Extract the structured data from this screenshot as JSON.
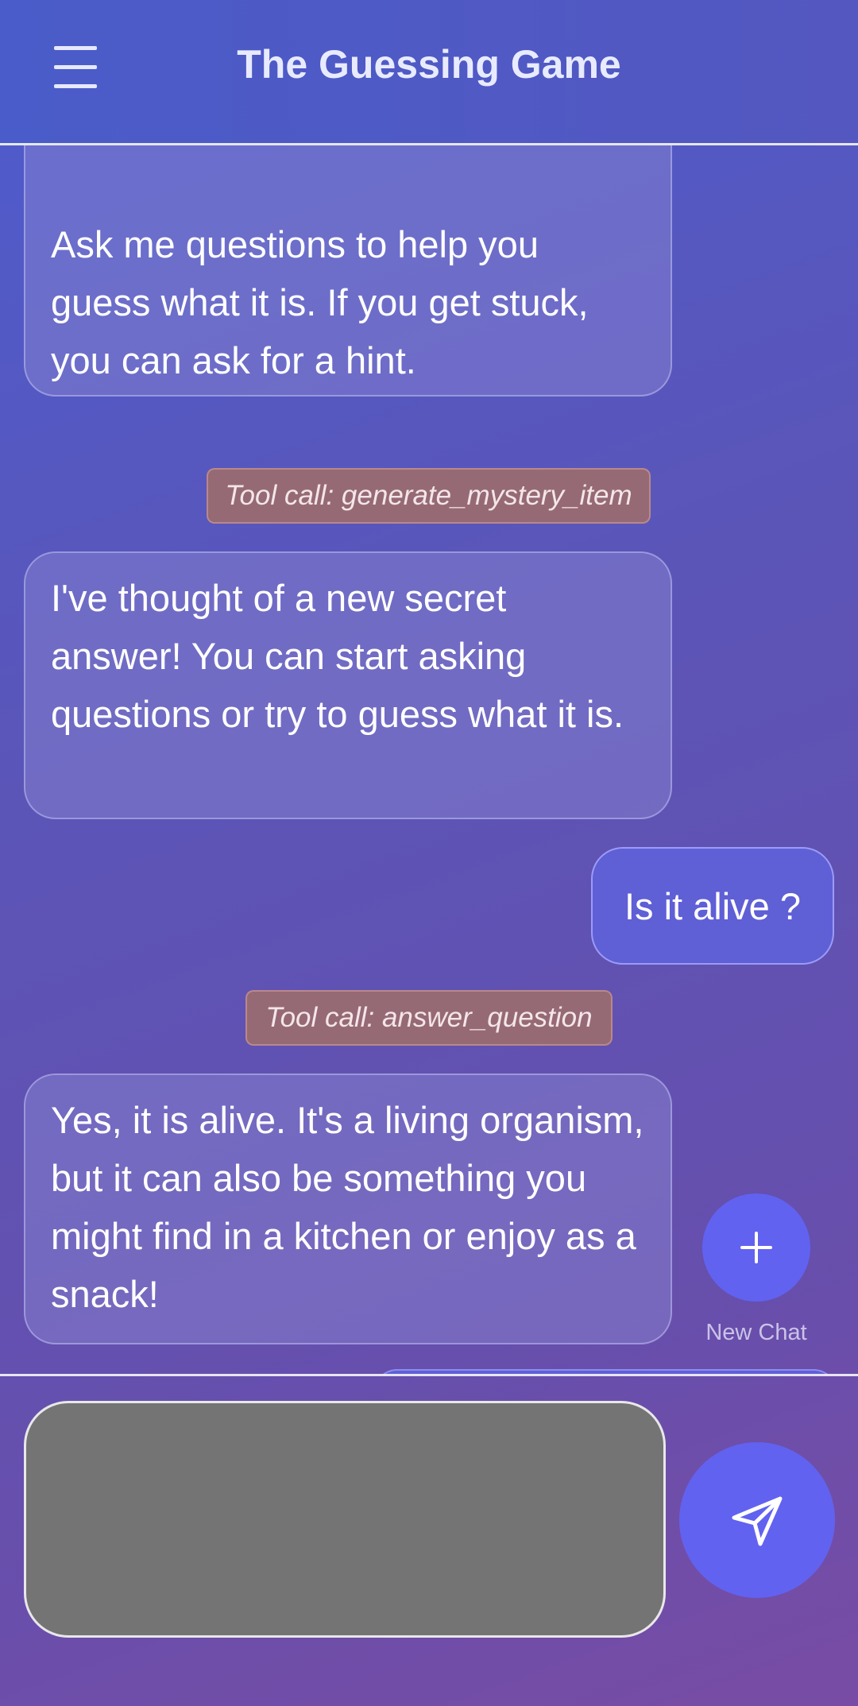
{
  "app": {
    "title": "The Guessing Game"
  },
  "messages": [
    {
      "role": "assistant",
      "text": "as the SECRET ANSWER.\n\nAsk me questions to help you guess what it is. If you get stuck, you can ask for a hint."
    },
    {
      "role": "tool",
      "text": "Tool call: generate_mystery_item"
    },
    {
      "role": "assistant",
      "text": "I've thought of a new secret answer! You can start asking questions or try to guess what it is."
    },
    {
      "role": "user",
      "text": "Is it alive ?"
    },
    {
      "role": "tool",
      "text": "Tool call: answer_question"
    },
    {
      "role": "assistant",
      "text": "Yes, it is alive. It's a living organism, but it can also be something you might find in a kitchen or enjoy as a snack!"
    }
  ],
  "new_chat": {
    "label": "New Chat",
    "icon": "plus-icon"
  },
  "composer": {
    "value": "",
    "send_icon": "send-icon"
  },
  "colors": {
    "accent": "#6262f0",
    "tool_pill": "#966a74",
    "input_bg": "#747474"
  }
}
